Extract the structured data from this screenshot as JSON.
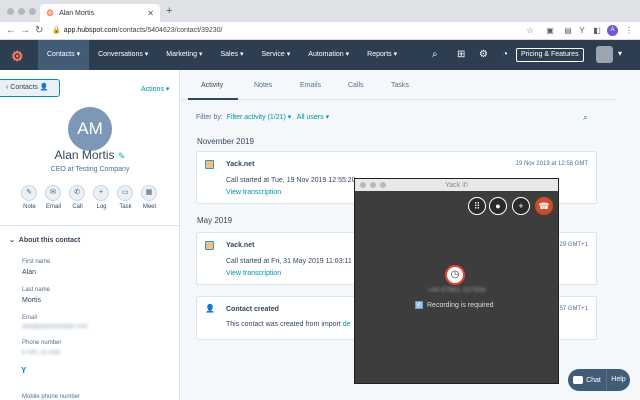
{
  "browser": {
    "tab_title": "Alan Mortis",
    "tab_favicon": "hubspot-sprocket",
    "url_host": "app.hubspot.com",
    "url_path": "/contacts/5404623/contact/39230/",
    "profile_initial": "A"
  },
  "hubspot_nav": {
    "items": [
      "Contacts ▾",
      "Conversations ▾",
      "Marketing ▾",
      "Sales ▾",
      "Service ▾",
      "Automation ▾",
      "Reports ▾"
    ],
    "pricing_label": "Pricing & Features"
  },
  "sidebar": {
    "contacts_label": "‹ Contacts",
    "actions_label": "Actions ▾",
    "avatar_initials": "AM",
    "name": "Alan Mortis",
    "job_title": "CEO at Testing Company",
    "quick_actions": [
      "Note",
      "Email",
      "Call",
      "Log",
      "Task",
      "Meet"
    ],
    "about_label": "About this contact",
    "first_name_label": "First name",
    "first_name_value": "Alan",
    "last_name_label": "Last name",
    "last_name_value": "Mortis",
    "email_label": "Email",
    "email_value": "alan@yackexample.com",
    "phone_label": "Phone number",
    "phone_value": "07961 157934",
    "mobile_label": "Mobile phone number"
  },
  "main": {
    "tabs": [
      "Activity",
      "Notes",
      "Emails",
      "Calls",
      "Tasks"
    ],
    "filter_by": "Filter by:",
    "filter_activity": "Filter activity (1/21) ▾",
    "all_users": "All users ▾",
    "groups": [
      {
        "month": "November 2019",
        "title": "Yack.net",
        "time": "19 Nov 2019 at 12:58 GMT",
        "text": "Call started at Tue, 19 Nov 2019 12:55:20",
        "link": "View transcription"
      },
      {
        "month": "May 2019",
        "title": "Yack.net",
        "time": "29 GMT+1",
        "text": "Call started at Fri, 31 May 2019 11:03:11",
        "link": "View transcription"
      }
    ],
    "created_title": "Contact created",
    "created_time": "57 GMT+1",
    "created_text": "This contact was created from import",
    "created_link": "de"
  },
  "yack": {
    "title": "Yack",
    "number": "+44 07961 157934",
    "recording_label": "Recording is required"
  },
  "chat": {
    "chat_label": "Chat",
    "help_label": "Help"
  },
  "colors": {
    "nav_bg": "#2d3e50",
    "accent": "#0091ae",
    "hubspot_orange": "#ff7a59",
    "hangup_red": "#d24a2a"
  }
}
